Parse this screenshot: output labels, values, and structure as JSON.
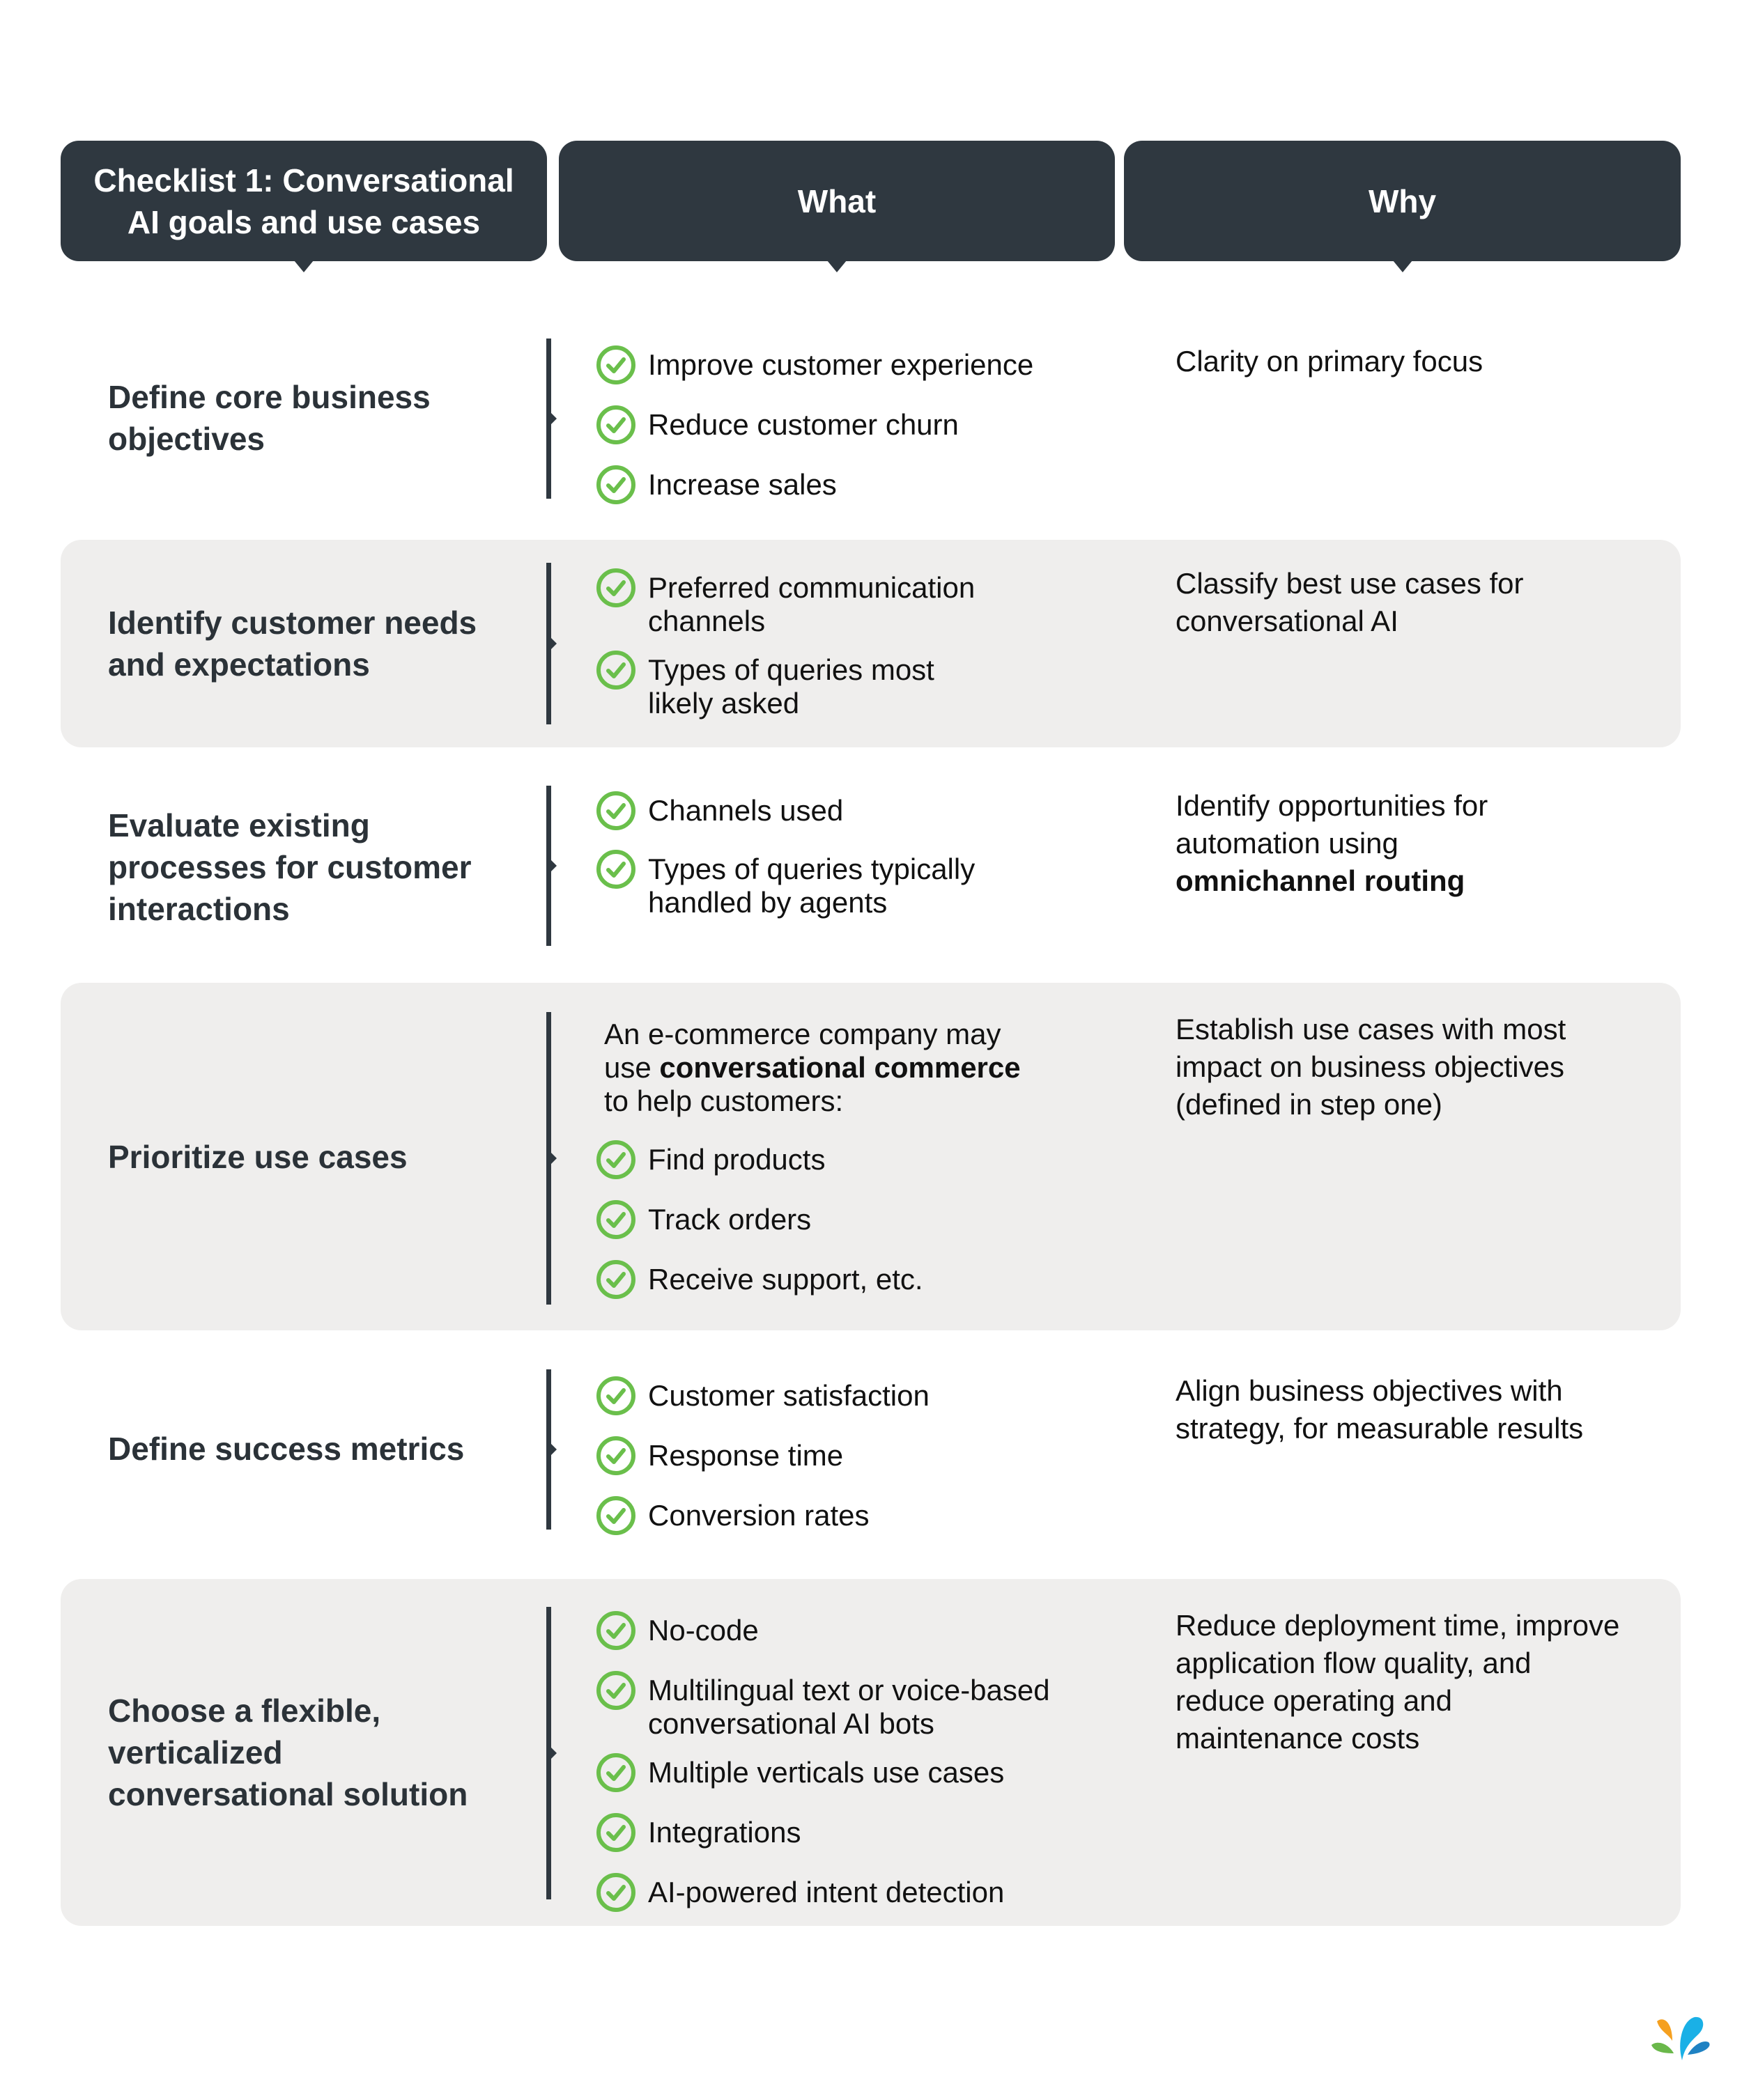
{
  "header": {
    "title": "Checklist 1: Conversational AI goals and use cases",
    "what_label": "What",
    "why_label": "Why"
  },
  "colors": {
    "header_bg": "#2f3840",
    "row_gray": "#efeeed",
    "check_green": "#6abf4b"
  },
  "rows": [
    {
      "step": "Define core business objectives",
      "what_items": [
        "Improve customer experience",
        "Reduce customer churn",
        "Increase sales"
      ],
      "why": "Clarity on primary focus"
    },
    {
      "step": "Identify customer needs and expectations",
      "what_items": [
        "Preferred communication channels",
        "Types of queries most likely asked"
      ],
      "why": "Classify best use cases for conversational AI"
    },
    {
      "step": "Evaluate existing processes for customer interactions",
      "what_items": [
        "Channels used",
        "Types of queries typically handled by agents"
      ],
      "why_prefix": "Identify opportunities for automation using",
      "why_bold": "omnichannel routing"
    },
    {
      "step": "Prioritize use cases",
      "what_intro_prefix": "An e-commerce company may use",
      "what_intro_bold": "conversational commerce",
      "what_intro_suffix": "to help customers:",
      "what_items": [
        "Find products",
        "Track orders",
        "Receive support, etc."
      ],
      "why": "Establish use cases with most impact on business objectives (defined in step one)"
    },
    {
      "step": "Define success metrics",
      "what_items": [
        "Customer satisfaction",
        "Response time",
        "Conversion rates"
      ],
      "why": "Align business objectives with strategy, for measurable results"
    },
    {
      "step": "Choose a flexible, verticalized conversational solution",
      "what_items": [
        "No-code",
        "Multilingual text or voice-based conversational AI bots",
        "Multiple verticals use cases",
        "Integrations",
        "AI-powered intent detection"
      ],
      "why": "Reduce deployment time, improve application flow quality, and reduce operating and maintenance costs"
    }
  ],
  "logo": {
    "icon": "brand-splash-logo"
  }
}
